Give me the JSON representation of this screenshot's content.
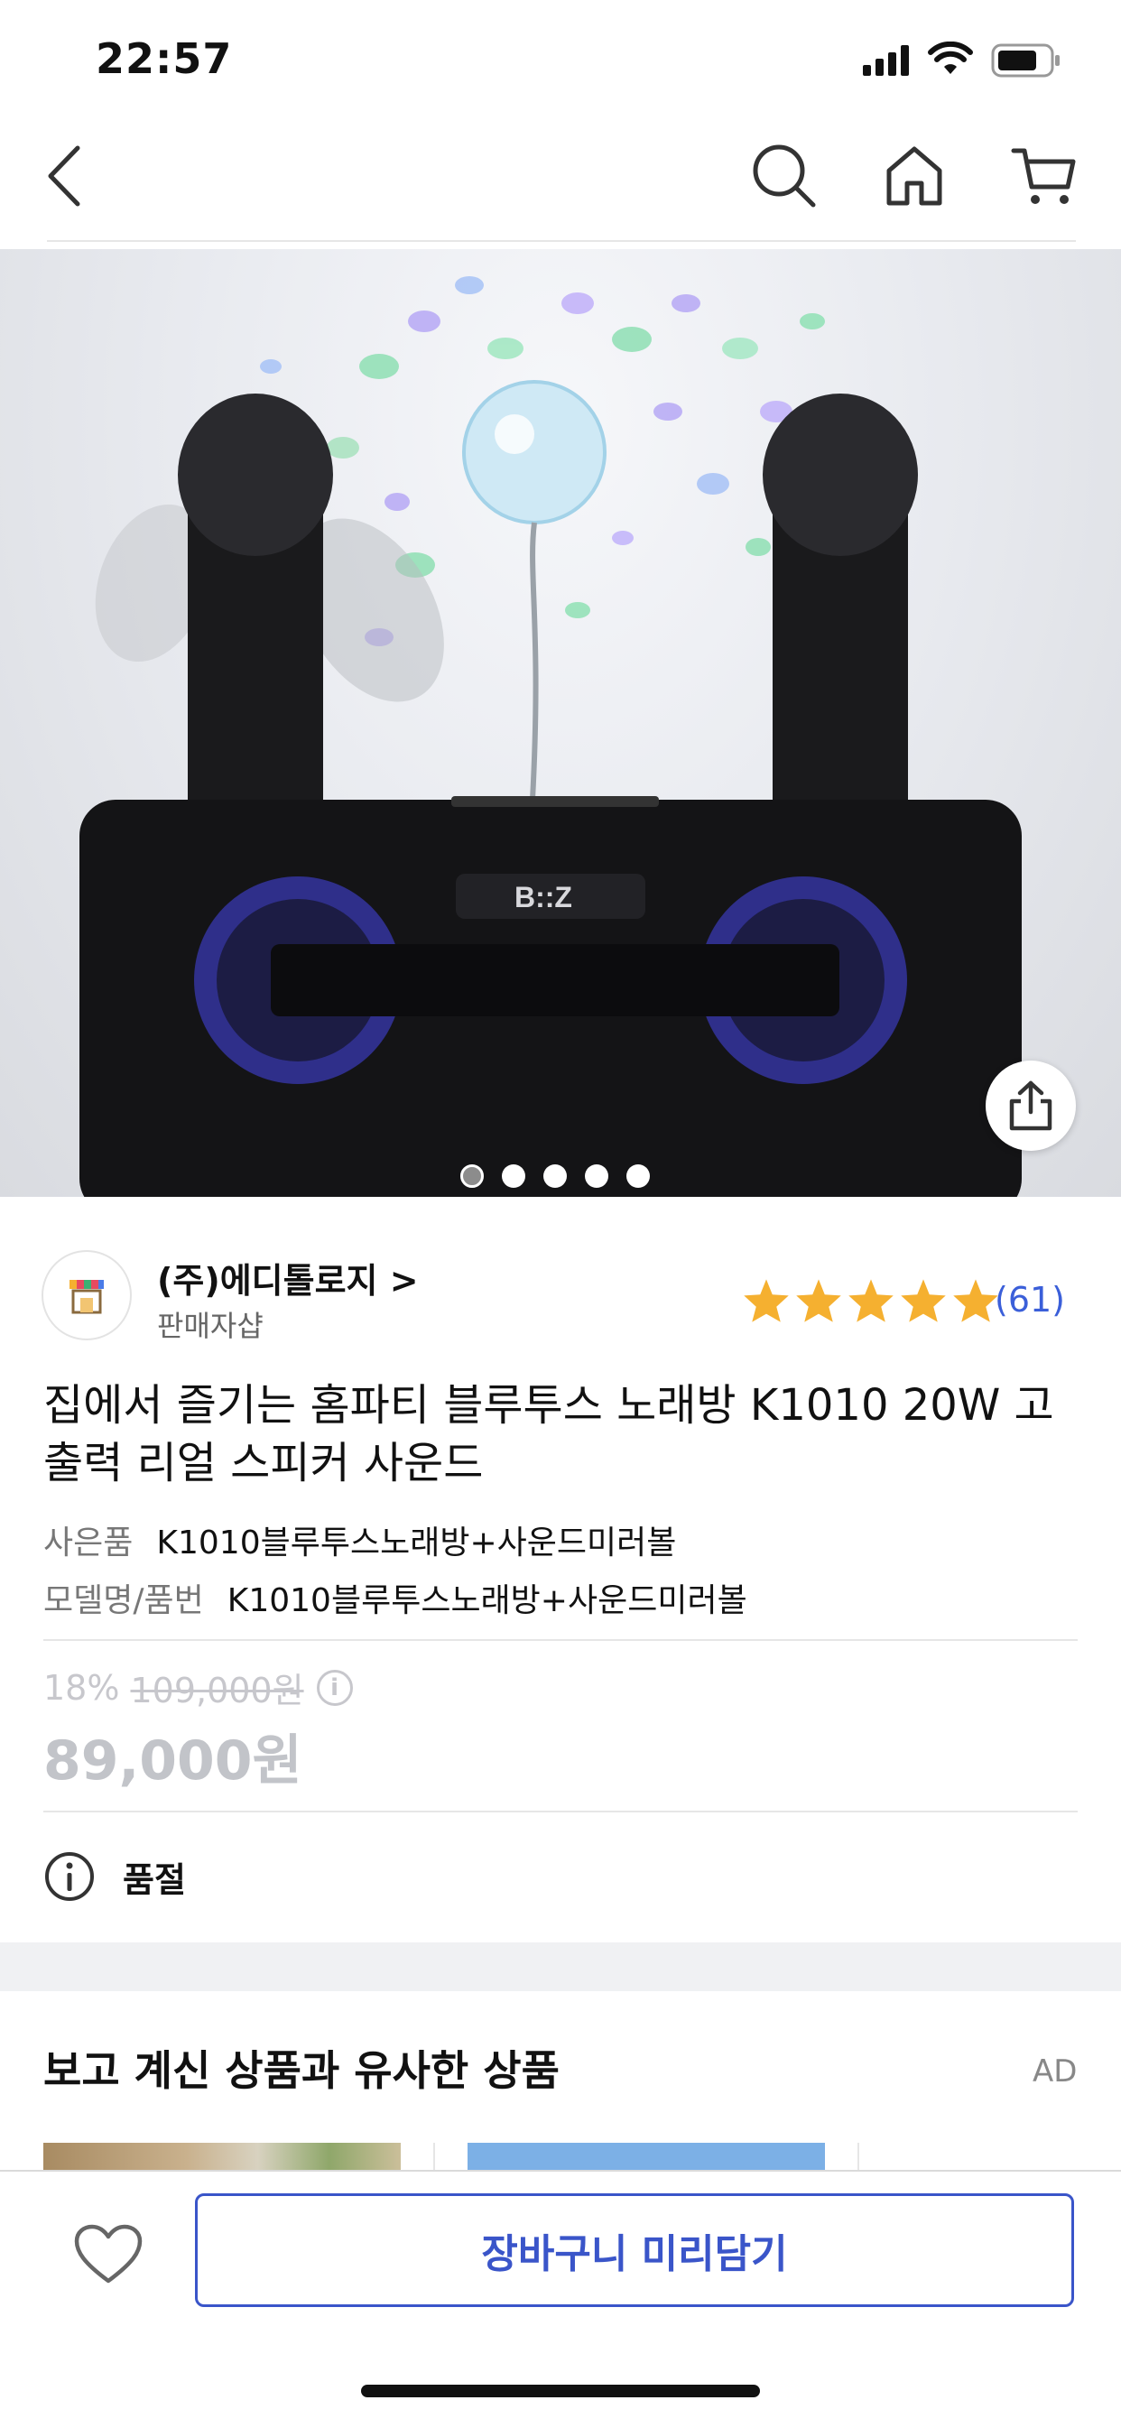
{
  "status_bar": {
    "time": "22:57"
  },
  "seller": {
    "name": "(주)에디톨로지 >",
    "type": "판매자샵"
  },
  "rating": {
    "stars": 5,
    "review_count": "(61)"
  },
  "product": {
    "title": "집에서 즐기는 홈파티 블루투스 노래방 K1010 20W 고출력 리얼 스피커 사운드",
    "options": [
      {
        "label": "사은품",
        "value": "K1010블루투스노래방+사운드미러볼"
      },
      {
        "label": "모델명/품번",
        "value": "K1010블루투스노래방+사운드미러볼"
      }
    ],
    "discount": "18%",
    "original_price": "109,000원",
    "price": "89,000원",
    "status": "품절"
  },
  "image_pager": {
    "count": 5,
    "active_index": 0
  },
  "hero_image": {
    "brand_text": "B::Z"
  },
  "similar": {
    "title": "보고 계신 상품과 유사한 상품",
    "ad_label": "AD"
  },
  "bottom": {
    "cart_button": "장바구니 미리담기"
  },
  "colors": {
    "accent": "#3a55c9",
    "star": "#f5b030",
    "review_count": "#3b5fd9"
  }
}
